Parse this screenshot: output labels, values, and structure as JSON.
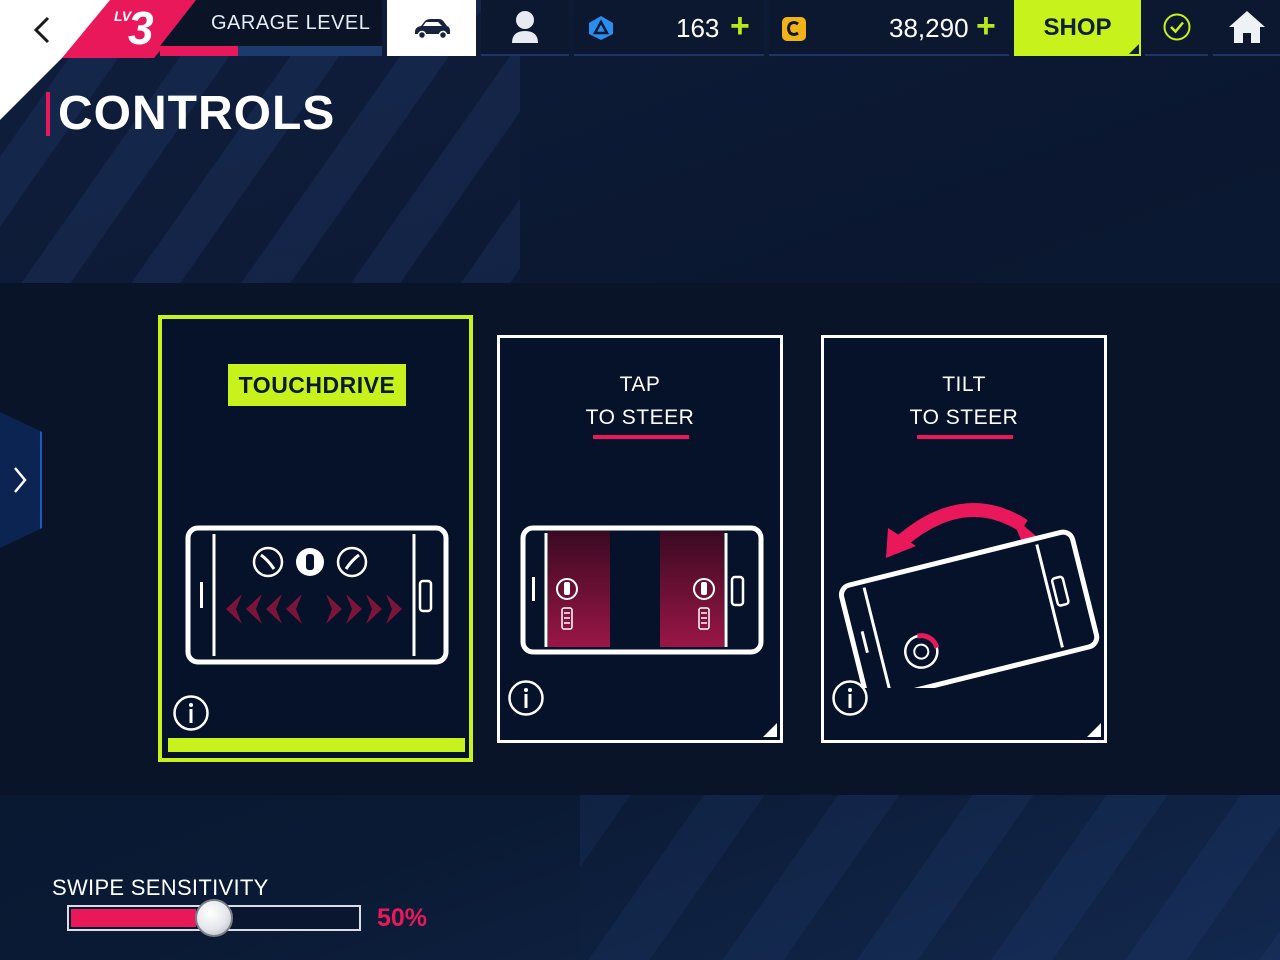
{
  "topbar": {
    "level_prefix": "LV",
    "level": "3",
    "garage_label": "GARAGE LEVEL",
    "garage_progress": 0.35,
    "blue_currency": "163",
    "gold_currency": "38,290",
    "plus_symbol": "+",
    "shop_label": "SHOP",
    "icons": {
      "back": "chevron-left-icon",
      "car": "car-icon",
      "profile": "profile-icon",
      "blue_token": "blue-token-icon",
      "gold_coin": "gold-coin-icon",
      "check": "check-icon",
      "home": "home-icon"
    }
  },
  "page": {
    "title": "CONTROLS"
  },
  "cards": [
    {
      "id": "touchdrive",
      "title": "TOUCHDRIVE",
      "selected": true
    },
    {
      "id": "tap",
      "title_line1": "TAP",
      "title_line2": "TO STEER",
      "selected": false
    },
    {
      "id": "tilt",
      "title_line1": "TILT",
      "title_line2": "TO STEER",
      "selected": false
    }
  ],
  "settings": {
    "swipe_label": "SWIPE SENSITIVITY",
    "swipe_value": "50%",
    "swipe_fraction": 0.5
  },
  "colors": {
    "accent_green": "#c8f21b",
    "accent_pink": "#e8185a",
    "panel": "#06122a",
    "background": "#0b1730"
  }
}
